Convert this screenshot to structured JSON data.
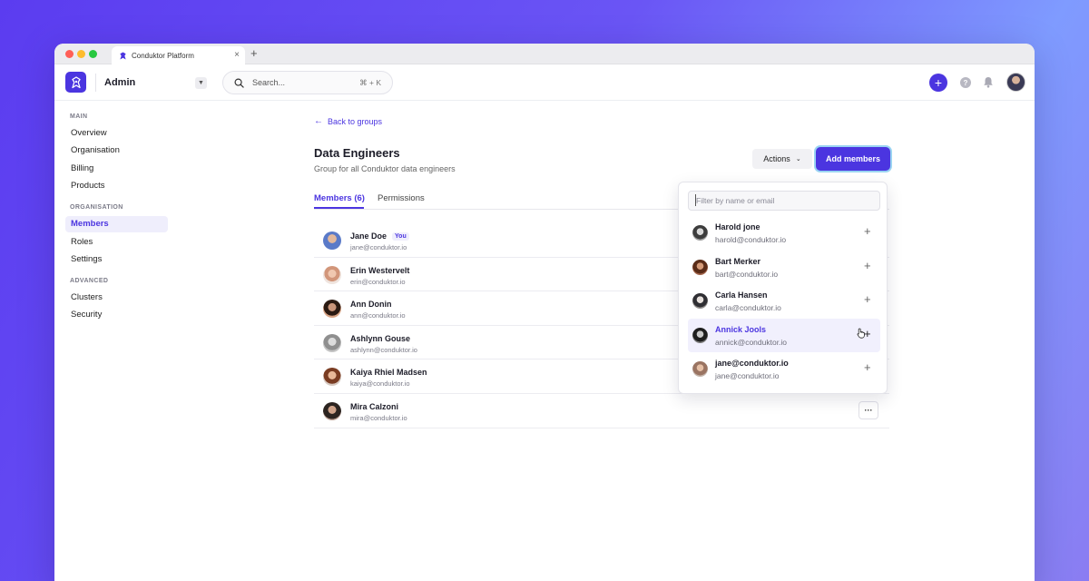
{
  "browser": {
    "tab_title": "Conduktor Platform",
    "tab_close": "×",
    "new_tab": "+"
  },
  "header": {
    "org_name": "Admin",
    "search_placeholder": "Search...",
    "search_shortcut": "⌘ + K",
    "plus_label": "+",
    "help_label": "?"
  },
  "sidebar": {
    "sections": [
      {
        "title": "MAIN",
        "items": [
          "Overview",
          "Organisation",
          "Billing",
          "Products"
        ]
      },
      {
        "title": "ORGANISATION",
        "items": [
          "Members",
          "Roles",
          "Settings"
        ]
      },
      {
        "title": "ADVANCED",
        "items": [
          "Clusters",
          "Security"
        ]
      }
    ],
    "active_item": "Members"
  },
  "main": {
    "back_link": "Back to groups",
    "title": "Data Engineers",
    "description": "Group for all Conduktor data engineers",
    "actions_label": "Actions",
    "add_members_label": "Add members",
    "tabs": [
      {
        "label": "Members (6)",
        "active": true
      },
      {
        "label": "Permissions",
        "active": false
      }
    ],
    "members": [
      {
        "name": "Jane Doe",
        "email": "jane@conduktor.io",
        "badge": "You"
      },
      {
        "name": "Erin Westervelt",
        "email": "erin@conduktor.io"
      },
      {
        "name": "Ann Donin",
        "email": "ann@conduktor.io"
      },
      {
        "name": "Ashlynn Gouse",
        "email": "ashlynn@conduktor.io"
      },
      {
        "name": "Kaiya Rhiel Madsen",
        "email": "kaiya@conduktor.io"
      },
      {
        "name": "Mira Calzoni",
        "email": "mira@conduktor.io"
      }
    ],
    "more_label": "···"
  },
  "dropdown": {
    "filter_placeholder": "Filter by name or email",
    "filter_value": "",
    "items": [
      {
        "name": "Harold jone",
        "email": "harold@conduktor.io"
      },
      {
        "name": "Bart Merker",
        "email": "bart@conduktor.io"
      },
      {
        "name": "Carla Hansen",
        "email": "carla@conduktor.io"
      },
      {
        "name": "Annick Jools",
        "email": "annick@conduktor.io",
        "hover": true
      },
      {
        "name": "jane@conduktor.io",
        "email": "jane@conduktor.io"
      }
    ],
    "add_label": "+"
  },
  "colors": {
    "accent": "#4b35e0",
    "accent_light": "#efeefc",
    "focus_ring": "#9ad4f2"
  }
}
